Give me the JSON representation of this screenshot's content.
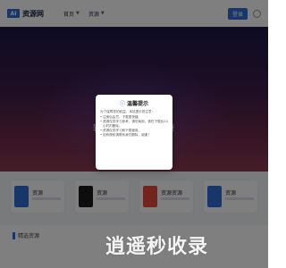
{
  "header": {
    "logo_mark": "AI",
    "logo_text": "资源网",
    "nav": [
      {
        "label": "首页",
        "has_caret": true
      },
      {
        "label": "资源",
        "has_caret": true
      }
    ],
    "login_label": "登录"
  },
  "hero": {
    "title": "输入关键 搜索资源"
  },
  "cards": [
    {
      "label": "资源",
      "color": "#2f6fd6"
    },
    {
      "label": "资源",
      "color": "#1a1a1a"
    },
    {
      "label": "资源资源",
      "color": "#e24a3b"
    },
    {
      "label": "资源",
      "color": "#2f6fd6"
    }
  ],
  "section": {
    "title": "精选资源"
  },
  "modal": {
    "title": "温馨提示",
    "intro": "为了保障您的权益，本站提示您注意：",
    "items": [
      "注册后会员，下载更快捷。",
      "资源仅供学习参考，请勿商用，请在下载后24小时内删除。",
      "资源仅供学习和下载使用。",
      "如有侵权请联系我们删除，谢谢！"
    ]
  },
  "watermark": "逍遥秒收录",
  "colors": {
    "accent": "#2f6fd6",
    "hero_top": "#1b1946",
    "hero_bottom": "#8a3a52"
  }
}
